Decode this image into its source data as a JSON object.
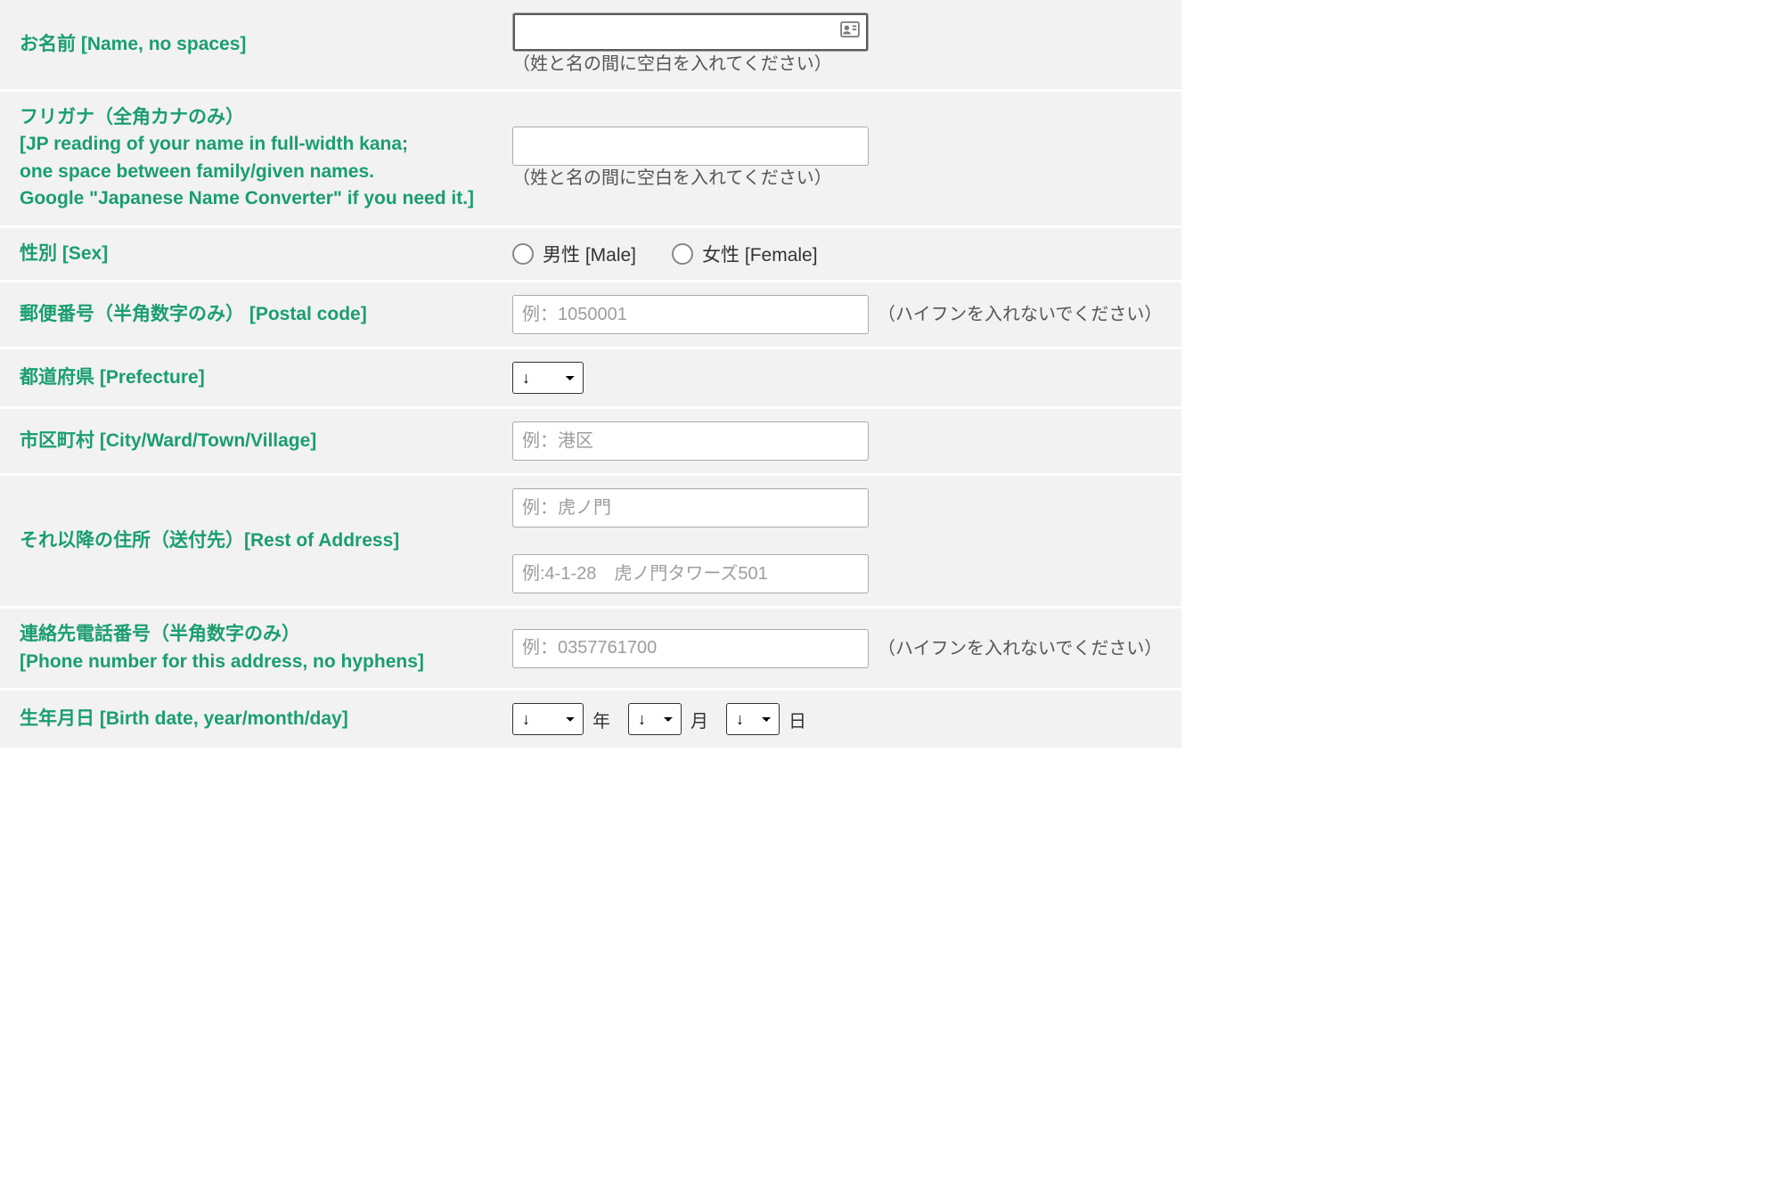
{
  "fields": {
    "name": {
      "label": "お名前 [Name, no spaces]",
      "hint": "（姓と名の間に空白を入れてください）"
    },
    "furigana": {
      "label": "フリガナ（全角カナのみ）\n[JP reading of your name in full-width kana;\none space between family/given names.\nGoogle \"Japanese Name Converter\" if you need it.]",
      "hint": "（姓と名の間に空白を入れてください）"
    },
    "sex": {
      "label": "性別 [Sex]",
      "options": {
        "male": "男性 [Male]",
        "female": "女性 [Female]"
      }
    },
    "postal": {
      "label": "郵便番号（半角数字のみ） [Postal code]",
      "placeholder": "例：1050001",
      "hint": "（ハイフンを入れないでください）"
    },
    "prefecture": {
      "label": "都道府県 [Prefecture]",
      "selected": "↓"
    },
    "city": {
      "label": "市区町村 [City/Ward/Town/Village]",
      "placeholder": "例：港区"
    },
    "rest_address": {
      "label": "それ以降の住所（送付先）[Rest of Address]",
      "placeholder1": "例：虎ノ門",
      "placeholder2": "例:4-1-28　虎ノ門タワーズ501"
    },
    "phone": {
      "label": "連絡先電話番号（半角数字のみ）\n[Phone number for this address, no hyphens]",
      "placeholder": "例：0357761700",
      "hint": "（ハイフンを入れないでください）"
    },
    "birthdate": {
      "label": "生年月日 [Birth date, year/month/day]",
      "selected": "↓",
      "units": {
        "year": "年",
        "month": "月",
        "day": "日"
      }
    }
  }
}
